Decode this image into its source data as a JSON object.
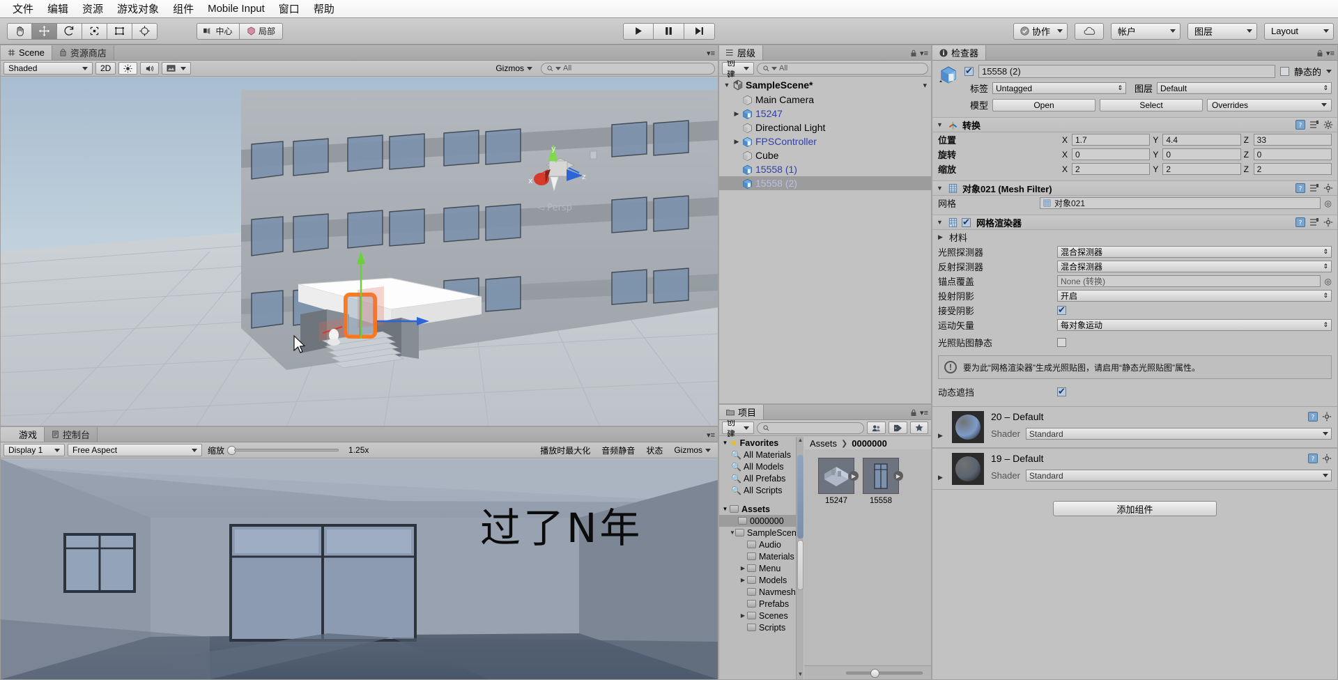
{
  "menubar": {
    "items": [
      "文件",
      "编辑",
      "资源",
      "游戏对象",
      "组件",
      "Mobile Input",
      "窗口",
      "帮助"
    ]
  },
  "toolbar": {
    "tools": [
      {
        "name": "hand-tool",
        "icon": "hand",
        "active": false
      },
      {
        "name": "move-tool",
        "icon": "move",
        "active": true
      },
      {
        "name": "rotate-tool",
        "icon": "rotate",
        "active": false
      },
      {
        "name": "scale-tool",
        "icon": "scale",
        "active": false
      },
      {
        "name": "rect-tool",
        "icon": "rect",
        "active": false
      },
      {
        "name": "transform-tool",
        "icon": "transform",
        "active": false
      }
    ],
    "pivot_label": "中心",
    "pivot_rotation_label": "局部",
    "play_label": "▶",
    "pause_label": "❚❚",
    "step_label": "▶❚",
    "collab_label": "协作",
    "cloud_label": "",
    "account_label": "帐户",
    "layers_label": "图层",
    "layout_label": "Layout"
  },
  "scene_panel": {
    "tabs": [
      {
        "label": "Scene",
        "icon": "grid-icon",
        "active": true
      },
      {
        "label": "资源商店",
        "icon": "store-icon",
        "active": false
      }
    ],
    "draw_mode": "Shaded",
    "two_d_label": "2D",
    "gizmos_label": "Gizmos",
    "search_placeholder": "All",
    "gizmo_axes": {
      "x": "x",
      "y": "y",
      "z": "z"
    },
    "persp_label": "Persp"
  },
  "game_panel": {
    "tabs": [
      {
        "label": "游戏",
        "icon": "game-icon",
        "active": true
      },
      {
        "label": "控制台",
        "icon": "console-icon",
        "active": false
      }
    ],
    "display": "Display 1",
    "aspect": "Free Aspect",
    "scale_label": "缩放",
    "scale_value": "1.25x",
    "maximize_label": "播放时最大化",
    "mute_label": "音频静音",
    "stats_label": "状态",
    "gizmos_label": "Gizmos",
    "overlay_text": "过了N年"
  },
  "hierarchy": {
    "tab_label": "层级",
    "create_label": "创建",
    "search_placeholder": "All",
    "scene_name": "SampleScene*",
    "items": [
      {
        "label": "Main Camera",
        "icon": "gameobject-icon",
        "expandable": false,
        "indent": 1,
        "selected": false,
        "prefab": false
      },
      {
        "label": "15247",
        "icon": "prefab-icon",
        "expandable": true,
        "indent": 1,
        "selected": false,
        "prefab": true
      },
      {
        "label": "Directional Light",
        "icon": "gameobject-icon",
        "expandable": false,
        "indent": 1,
        "selected": false,
        "prefab": false
      },
      {
        "label": "FPSController",
        "icon": "prefab-icon-blue",
        "expandable": true,
        "indent": 1,
        "selected": false,
        "prefab": true
      },
      {
        "label": "Cube",
        "icon": "gameobject-icon",
        "expandable": false,
        "indent": 1,
        "selected": false,
        "prefab": false
      },
      {
        "label": "15558 (1)",
        "icon": "prefab-icon",
        "expandable": false,
        "indent": 1,
        "selected": false,
        "prefab": true
      },
      {
        "label": "15558 (2)",
        "icon": "prefab-icon",
        "expandable": false,
        "indent": 1,
        "selected": true,
        "prefab": true
      }
    ]
  },
  "inspector": {
    "tab_label": "检查器",
    "object_name": "15558 (2)",
    "enabled": true,
    "static_label": "静态的",
    "static_checked": false,
    "tag_label": "标签",
    "tag_value": "Untagged",
    "layer_label": "图层",
    "layer_value": "Default",
    "model_label": "模型",
    "open_label": "Open",
    "select_label": "Select",
    "overrides_label": "Overrides",
    "transform": {
      "title": "转换",
      "position_label": "位置",
      "rotation_label": "旋转",
      "scale_label": "缩放",
      "position": {
        "x": "1.7",
        "y": "4.4",
        "z": "33"
      },
      "rotation": {
        "x": "0",
        "y": "0",
        "z": "0"
      },
      "scale": {
        "x": "2",
        "y": "2",
        "z": "2"
      }
    },
    "mesh_filter": {
      "title": "对象021 (Mesh Filter)",
      "mesh_label": "网格",
      "mesh_value": "对象021"
    },
    "mesh_renderer": {
      "title": "网格渲染器",
      "enabled": true,
      "materials_label": "材料",
      "light_probes_label": "光照探测器",
      "light_probes_value": "混合探测器",
      "reflection_probes_label": "反射探测器",
      "reflection_probes_value": "混合探测器",
      "anchor_override_label": "锚点覆盖",
      "anchor_override_value": "None (转换)",
      "cast_shadows_label": "投射阴影",
      "cast_shadows_value": "开启",
      "receive_shadows_label": "接受阴影",
      "receive_shadows_checked": true,
      "motion_vectors_label": "运动矢量",
      "motion_vectors_value": "每对象运动",
      "lightmap_static_label": "光照贴图静态",
      "lightmap_static_checked": false,
      "warning_text": "要为此“网格渲染器”生成光照贴图，请启用“静态光照贴图”属性。",
      "dynamic_occlusion_label": "动态遮挡",
      "dynamic_occlusion_checked": true
    },
    "materials": [
      {
        "name": "20 – Default",
        "shader_label": "Shader",
        "shader_value": "Standard",
        "color": "#7d9cc8"
      },
      {
        "name": "19 – Default",
        "shader_label": "Shader",
        "shader_value": "Standard",
        "color": "#5a6470"
      }
    ],
    "add_component_label": "添加组件"
  },
  "project": {
    "tab_label": "项目",
    "create_label": "创建",
    "search_placeholder": "",
    "favorites_label": "Favorites",
    "favorites": [
      "All Materials",
      "All Models",
      "All Prefabs",
      "All Scripts"
    ],
    "assets_label": "Assets",
    "tree": [
      {
        "label": "0000000",
        "indent": 1,
        "expandable": false,
        "selected": true
      },
      {
        "label": "SampleScene",
        "indent": 1,
        "expandable": true,
        "selected": false
      },
      {
        "label": "Audio",
        "indent": 2,
        "expandable": false,
        "selected": false
      },
      {
        "label": "Materials",
        "indent": 2,
        "expandable": false,
        "selected": false
      },
      {
        "label": "Menu",
        "indent": 2,
        "expandable": true,
        "selected": false
      },
      {
        "label": "Models",
        "indent": 2,
        "expandable": true,
        "selected": false
      },
      {
        "label": "Navmesh",
        "indent": 2,
        "expandable": false,
        "selected": false
      },
      {
        "label": "Prefabs",
        "indent": 2,
        "expandable": false,
        "selected": false
      },
      {
        "label": "Scenes",
        "indent": 2,
        "expandable": true,
        "selected": false
      },
      {
        "label": "Scripts",
        "indent": 2,
        "expandable": false,
        "selected": false
      }
    ],
    "breadcrumb": [
      "Assets",
      "0000000"
    ],
    "assets": [
      {
        "name": "15247",
        "type": "model"
      },
      {
        "name": "15558",
        "type": "model"
      }
    ]
  }
}
